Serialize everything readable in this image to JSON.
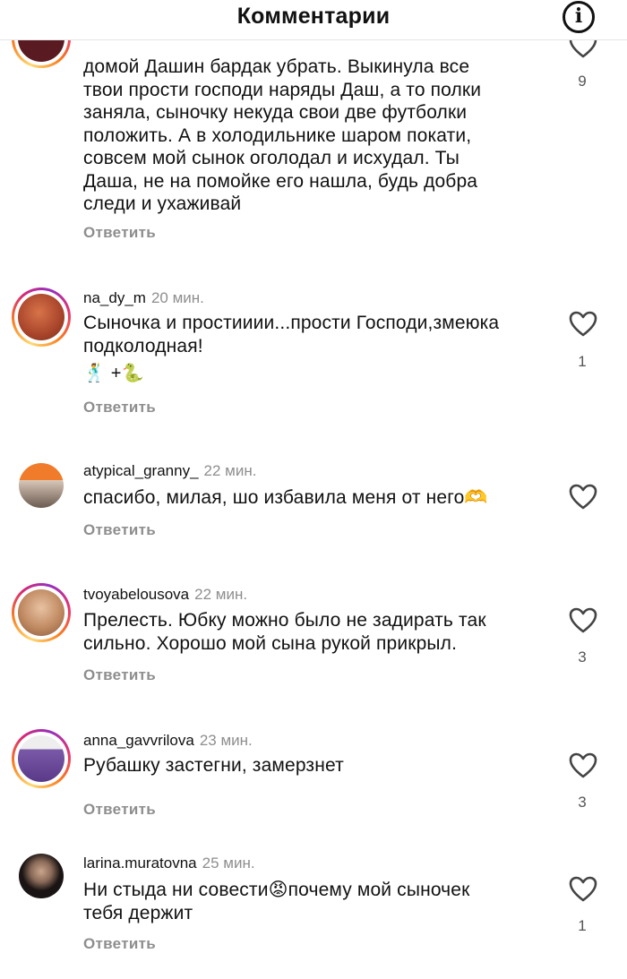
{
  "header": {
    "title": "Комментарии",
    "info_icon": "i"
  },
  "comments": [
    {
      "username": "",
      "time": "",
      "text_lines": [
        "домой Дашин бардак убрать. Выкинула все",
        "твои прости господи наряды Даш, а то полки",
        "заняла, сыночку некуда свои две футболки",
        "положить. А в холодильнике шаром покати,",
        "совсем мой сынок оголодал и исхудал. Ты",
        "Даша, не на помойке его нашла, будь добра",
        "следи и ухаживай"
      ],
      "reply": "Ответить",
      "likes": "9"
    },
    {
      "username": "na_dy_m",
      "time": "20 мин.",
      "text_lines": [
        "Сыночка и простииии...прости Господи,змеюка",
        "подколодная!",
        "🕺 +🐍"
      ],
      "reply": "Ответить",
      "likes": "1"
    },
    {
      "username": "atypical_granny_",
      "time": "22 мин.",
      "text_lines": [
        "спасибо, милая, шо избавила меня от него🫶"
      ],
      "reply": "Ответить",
      "likes": ""
    },
    {
      "username": "tvoyabelousova",
      "time": "22 мин.",
      "text_lines": [
        "Прелесть. Юбку можно было не задирать так",
        "сильно. Хорошо мой сына рукой прикрыл."
      ],
      "reply": "Ответить",
      "likes": "3"
    },
    {
      "username": "anna_gavvrilova",
      "time": "23 мин.",
      "text_lines": [
        "Рубашку застегни, замерзнет"
      ],
      "reply": "Ответить",
      "likes": "3"
    },
    {
      "username": "larina.muratovna",
      "time": "25 мин.",
      "text_lines": [
        "Ни стыда ни совести😡почему мой сыночек",
        "тебя держит"
      ],
      "reply": "Ответить",
      "likes": "1"
    }
  ]
}
